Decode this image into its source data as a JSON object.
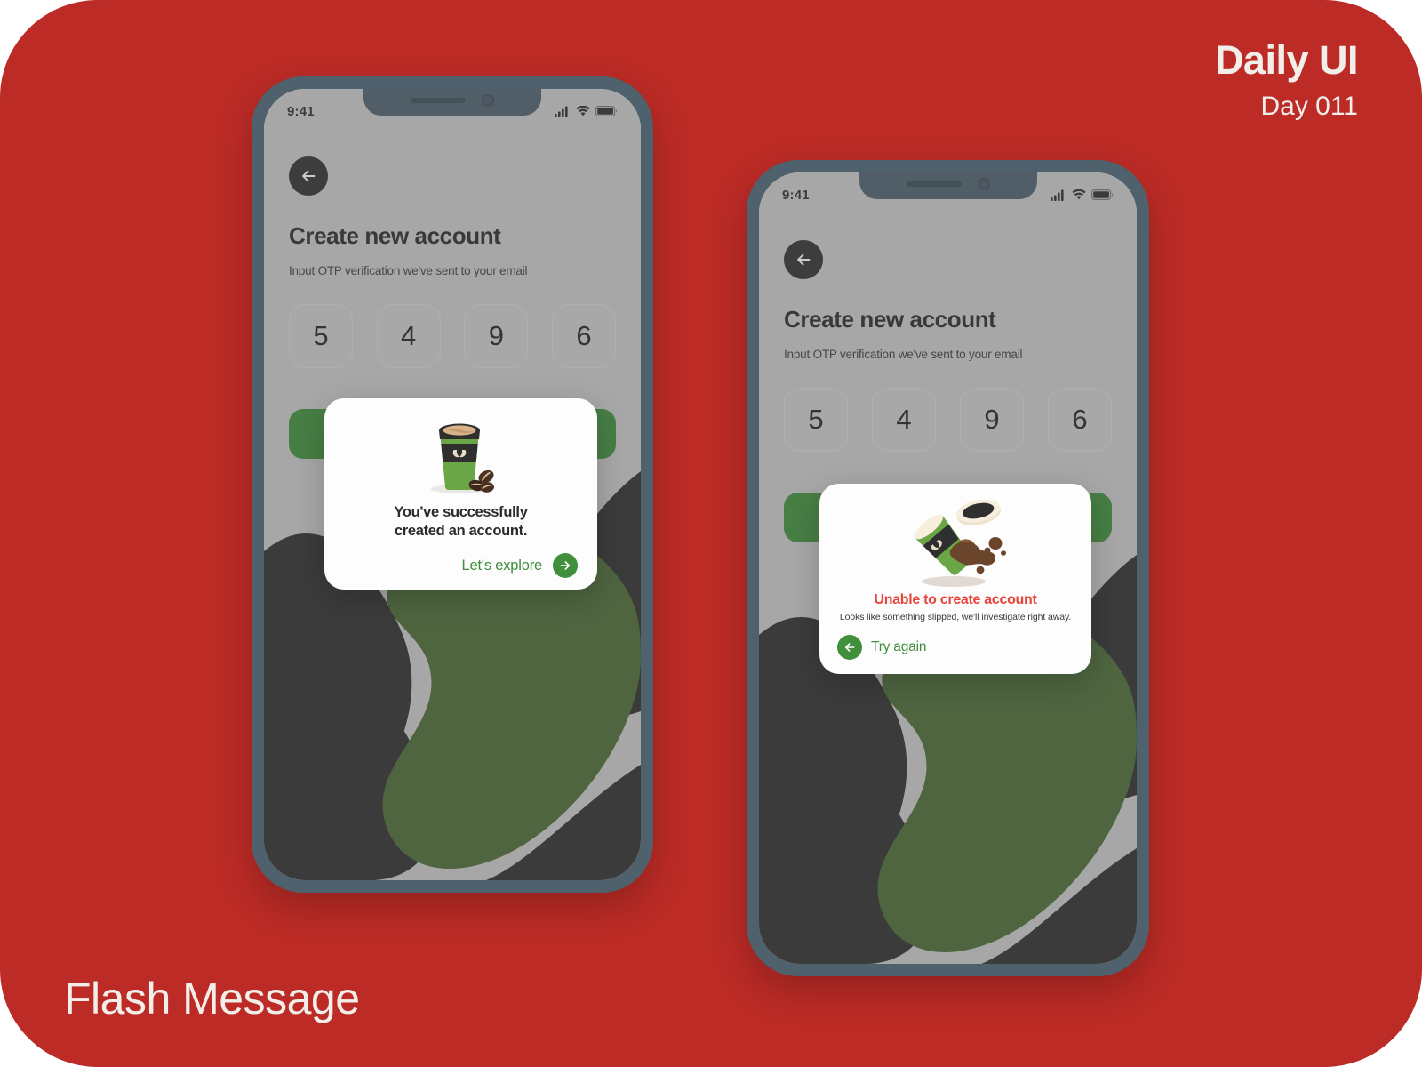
{
  "theme": {
    "background_red": "#bc2b26",
    "phone_frame": "#4e616d",
    "screen_gray": "#c9c9c9",
    "brand_green": "#3f8f3b",
    "blob_green": "#4a6b35",
    "dark_shape": "#2f2f2f",
    "error_red": "#e8453c",
    "header_text": "#f2eeea"
  },
  "header": {
    "title": "Daily UI",
    "day": "Day 011"
  },
  "footer": {
    "label": "Flash Message"
  },
  "phones": [
    {
      "id": "phone-success",
      "statusbar": {
        "time": "9:41",
        "icons": [
          "cellular-signal-icon",
          "wifi-icon",
          "battery-icon"
        ]
      },
      "back_button_icon": "arrow-left-icon",
      "title": "Create new account",
      "subtitle": "Input OTP verification we've sent to your email",
      "otp": [
        "5",
        "4",
        "9",
        "6"
      ],
      "modal": {
        "kind": "success",
        "illustration": "coffee-cup-with-beans-icon",
        "message": "You've successfully\ncreated an account.",
        "message_line1": "You've successfully",
        "message_line2": "created an account.",
        "action_label": "Let's explore",
        "action_icon": "arrow-right-circle-icon"
      }
    },
    {
      "id": "phone-error",
      "statusbar": {
        "time": "9:41",
        "icons": [
          "cellular-signal-icon",
          "wifi-icon",
          "battery-icon"
        ]
      },
      "back_button_icon": "arrow-left-icon",
      "title": "Create new account",
      "subtitle": "Input OTP verification we've sent to your email",
      "otp": [
        "5",
        "4",
        "9",
        "6"
      ],
      "modal": {
        "kind": "error",
        "illustration": "spilled-coffee-cup-icon",
        "title": "Unable to create account",
        "subtitle": "Looks like something slipped, we'll investigate right away.",
        "action_label": "Try again",
        "action_icon": "arrow-left-circle-icon"
      }
    }
  ]
}
